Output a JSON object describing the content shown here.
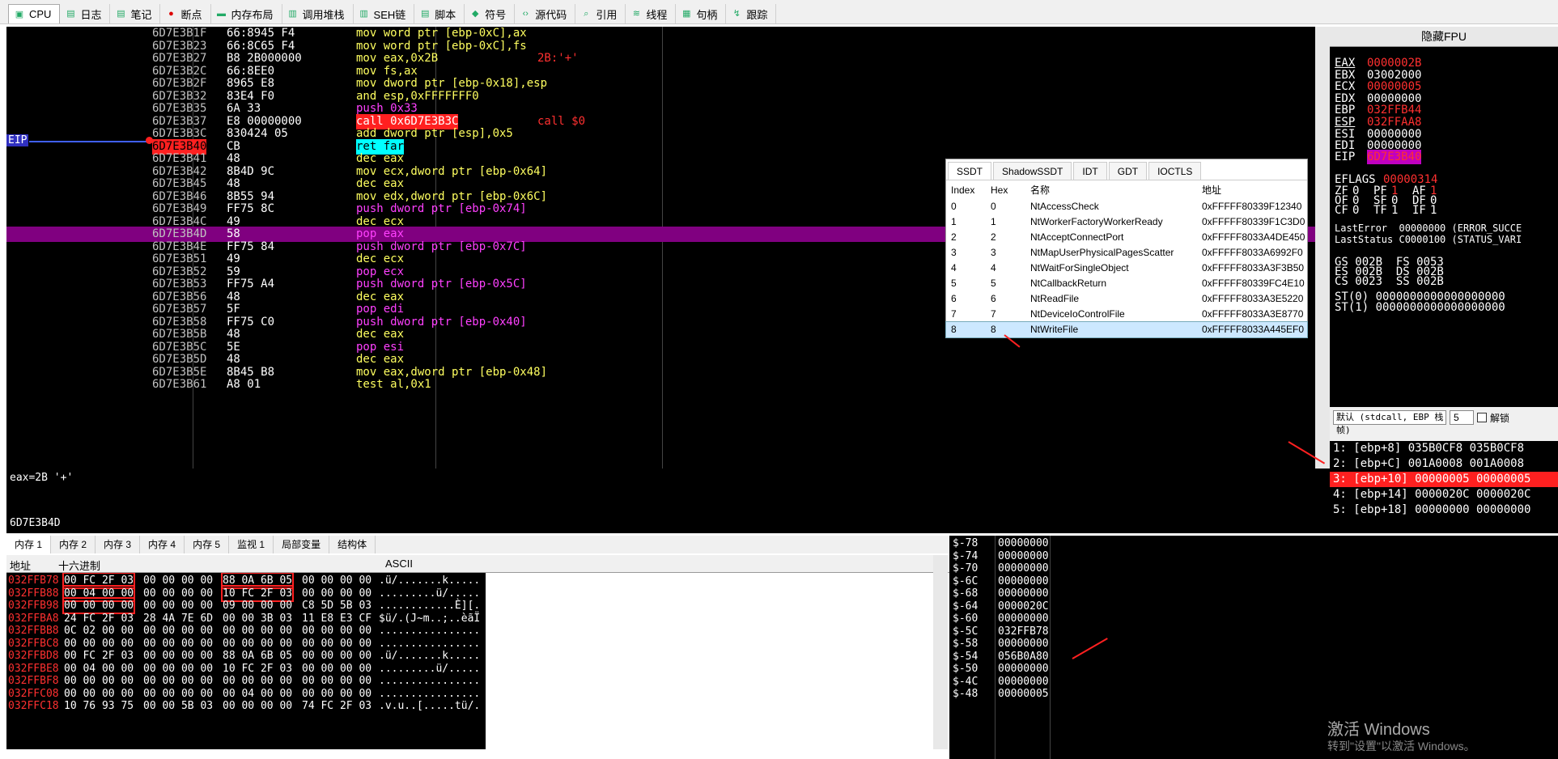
{
  "tabs": [
    {
      "label": "CPU",
      "icon": "cpu-icon"
    },
    {
      "label": "日志",
      "icon": "log-icon"
    },
    {
      "label": "笔记",
      "icon": "notes-icon"
    },
    {
      "label": "断点",
      "icon": "breakpoint-icon"
    },
    {
      "label": "内存布局",
      "icon": "memory-map-icon"
    },
    {
      "label": "调用堆栈",
      "icon": "callstack-icon"
    },
    {
      "label": "SEH链",
      "icon": "seh-icon"
    },
    {
      "label": "脚本",
      "icon": "script-icon"
    },
    {
      "label": "符号",
      "icon": "symbol-icon"
    },
    {
      "label": "源代码",
      "icon": "source-icon"
    },
    {
      "label": "引用",
      "icon": "references-icon"
    },
    {
      "label": "线程",
      "icon": "threads-icon"
    },
    {
      "label": "句柄",
      "icon": "handles-icon"
    },
    {
      "label": "跟踪",
      "icon": "trace-icon"
    }
  ],
  "eip_label": "EIP",
  "disasm": [
    {
      "a": "6D7E3B1F",
      "b": "66:8945 F4",
      "i": "mov word ptr [ebp-0xC],ax",
      "c": ""
    },
    {
      "a": "6D7E3B23",
      "b": "66:8C65 F4",
      "i": "mov word ptr [ebp-0xC],fs",
      "c": ""
    },
    {
      "a": "6D7E3B27",
      "b": "B8 2B000000",
      "i": "mov eax,0x2B",
      "c": "2B:'+'"
    },
    {
      "a": "6D7E3B2C",
      "b": "66:8EE0",
      "i": "mov fs,ax",
      "c": ""
    },
    {
      "a": "6D7E3B2F",
      "b": "8965 E8",
      "i": "mov dword ptr [ebp-0x18],esp",
      "c": ""
    },
    {
      "a": "6D7E3B32",
      "b": "83E4 F0",
      "i": "and esp,0xFFFFFFF0",
      "c": ""
    },
    {
      "a": "6D7E3B35",
      "b": "6A 33",
      "i": "push 0x33",
      "c": ""
    },
    {
      "a": "6D7E3B37",
      "b": "E8 00000000",
      "i": "call 0x6D7E3B3C",
      "c": "call $0"
    },
    {
      "a": "6D7E3B3C",
      "b": "830424 05",
      "i": "add dword ptr [esp],0x5",
      "c": ""
    },
    {
      "a": "6D7E3B40",
      "b": "CB",
      "i": "ret far",
      "c": ""
    },
    {
      "a": "6D7E3B41",
      "b": "48",
      "i": "dec eax",
      "c": ""
    },
    {
      "a": "6D7E3B42",
      "b": "8B4D 9C",
      "i": "mov ecx,dword ptr [ebp-0x64]",
      "c": ""
    },
    {
      "a": "6D7E3B45",
      "b": "48",
      "i": "dec eax",
      "c": ""
    },
    {
      "a": "6D7E3B46",
      "b": "8B55 94",
      "i": "mov edx,dword ptr [ebp-0x6C]",
      "c": ""
    },
    {
      "a": "6D7E3B49",
      "b": "FF75 8C",
      "i": "push dword ptr [ebp-0x74]",
      "c": ""
    },
    {
      "a": "6D7E3B4C",
      "b": "49",
      "i": "dec ecx",
      "c": ""
    },
    {
      "a": "6D7E3B4D",
      "b": "58",
      "i": "pop eax",
      "c": ""
    },
    {
      "a": "6D7E3B4E",
      "b": "FF75 84",
      "i": "push dword ptr [ebp-0x7C]",
      "c": ""
    },
    {
      "a": "6D7E3B51",
      "b": "49",
      "i": "dec ecx",
      "c": ""
    },
    {
      "a": "6D7E3B52",
      "b": "59",
      "i": "pop ecx",
      "c": ""
    },
    {
      "a": "6D7E3B53",
      "b": "FF75 A4",
      "i": "push dword ptr [ebp-0x5C]",
      "c": ""
    },
    {
      "a": "6D7E3B56",
      "b": "48",
      "i": "dec eax",
      "c": ""
    },
    {
      "a": "6D7E3B57",
      "b": "5F",
      "i": "pop edi",
      "c": ""
    },
    {
      "a": "6D7E3B58",
      "b": "FF75 C0",
      "i": "push dword ptr [ebp-0x40]",
      "c": ""
    },
    {
      "a": "6D7E3B5B",
      "b": "48",
      "i": "dec eax",
      "c": ""
    },
    {
      "a": "6D7E3B5C",
      "b": "5E",
      "i": "pop esi",
      "c": ""
    },
    {
      "a": "6D7E3B5D",
      "b": "48",
      "i": "dec eax",
      "c": ""
    },
    {
      "a": "6D7E3B5E",
      "b": "8B45 B8",
      "i": "mov eax,dword ptr [ebp-0x48]",
      "c": ""
    },
    {
      "a": "6D7E3B61",
      "b": "A8 01",
      "i": "test al,0x1",
      "c": ""
    }
  ],
  "fpu_title": "隐藏FPU",
  "registers": [
    {
      "n": "EAX",
      "v": "0000002B",
      "red": true,
      "u": true
    },
    {
      "n": "EBX",
      "v": "03002000",
      "red": false,
      "u": false
    },
    {
      "n": "ECX",
      "v": "00000005",
      "red": true,
      "u": false
    },
    {
      "n": "EDX",
      "v": "00000000",
      "red": false,
      "u": false
    },
    {
      "n": "EBP",
      "v": "032FFB44",
      "red": true,
      "u": false
    },
    {
      "n": "ESP",
      "v": "032FFAA8",
      "red": true,
      "u": true
    },
    {
      "n": "ESI",
      "v": "00000000",
      "red": false,
      "u": false
    },
    {
      "n": "EDI",
      "v": "00000000",
      "red": false,
      "u": false
    }
  ],
  "eip": {
    "n": "EIP",
    "v": "6D7E3B40"
  },
  "eflags": {
    "n": "EFLAGS",
    "v": "00000314"
  },
  "flags": [
    [
      "ZF",
      "0",
      "PF",
      "1",
      "AF",
      "1"
    ],
    [
      "OF",
      "0",
      "SF",
      "0",
      "DF",
      "0"
    ],
    [
      "CF",
      "0",
      "TF",
      "1",
      "IF",
      "1"
    ]
  ],
  "lasterror": "LastError  00000000 (ERROR_SUCCE",
  "laststatus": "LastStatus C0000100 (STATUS_VARI",
  "segs": [
    "GS 002B  FS 0053",
    "ES 002B  DS 002B",
    "CS 0023  SS 002B"
  ],
  "st0": "ST(0) 0000000000000000000",
  "st1": "ST(1) 0000000000000000000",
  "callconv": "默认 (stdcall, EBP 栈帧)",
  "argcount": "5",
  "unlock": "解锁",
  "stackargs": [
    "1: [ebp+8] 035B0CF8 035B0CF8",
    "2: [ebp+C] 001A0008 001A0008",
    "3: [ebp+10] 00000005 00000005",
    "4: [ebp+14] 0000020C 0000020C",
    "5: [ebp+18] 00000000 00000000"
  ],
  "info_line1": "eax=2B '+'",
  "info_line2": "6D7E3B4D",
  "memtabs": [
    "内存 1",
    "内存 2",
    "内存 3",
    "内存 4",
    "内存 5",
    "监视 1",
    "局部变量",
    "结构体"
  ],
  "memhdr": {
    "addr": "地址",
    "hex": "十六进制",
    "ascii": "ASCII"
  },
  "memory": [
    {
      "a": "032FFB78",
      "h": [
        "00 FC 2F 03",
        "00 00 00 00",
        "88 0A 6B 05",
        "00 00 00 00"
      ],
      "s": ".ü/.......k....."
    },
    {
      "a": "032FFB88",
      "h": [
        "00 04 00 00",
        "00 00 00 00",
        "10 FC 2F 03",
        "00 00 00 00"
      ],
      "s": ".........ü/....."
    },
    {
      "a": "032FFB98",
      "h": [
        "00 00 00 00",
        "00 00 00 00",
        "09 00 00 00",
        "C8 5D 5B 03"
      ],
      "s": "............È][."
    },
    {
      "a": "032FFBA8",
      "h": [
        "24 FC 2F 03",
        "28 4A 7E 6D",
        "00 00 3B 03",
        "11 E8 E3 CF"
      ],
      "s": "$ü/.(J~m..;..èãÏ"
    },
    {
      "a": "032FFBB8",
      "h": [
        "0C 02 00 00",
        "00 00 00 00",
        "00 00 00 00",
        "00 00 00 00"
      ],
      "s": "................"
    },
    {
      "a": "032FFBC8",
      "h": [
        "00 00 00 00",
        "00 00 00 00",
        "00 00 00 00",
        "00 00 00 00"
      ],
      "s": "................"
    },
    {
      "a": "032FFBD8",
      "h": [
        "00 FC 2F 03",
        "00 00 00 00",
        "88 0A 6B 05",
        "00 00 00 00"
      ],
      "s": ".ü/.......k....."
    },
    {
      "a": "032FFBE8",
      "h": [
        "00 04 00 00",
        "00 00 00 00",
        "10 FC 2F 03",
        "00 00 00 00"
      ],
      "s": ".........ü/....."
    },
    {
      "a": "032FFBF8",
      "h": [
        "00 00 00 00",
        "00 00 00 00",
        "00 00 00 00",
        "00 00 00 00"
      ],
      "s": "................"
    },
    {
      "a": "032FFC08",
      "h": [
        "00 00 00 00",
        "00 00 00 00",
        "00 04 00 00",
        "00 00 00 00"
      ],
      "s": "................"
    },
    {
      "a": "032FFC18",
      "h": [
        "10 76 93 75",
        "00 00 5B 03",
        "00 00 00 00",
        "74 FC 2F 03"
      ],
      "s": ".v.u..[.....tü/."
    }
  ],
  "stack": [
    {
      "o": "$-78",
      "v": "00000000"
    },
    {
      "o": "$-74",
      "v": "00000000"
    },
    {
      "o": "$-70",
      "v": "00000000"
    },
    {
      "o": "$-6C",
      "v": "00000000"
    },
    {
      "o": "$-68",
      "v": "00000000"
    },
    {
      "o": "$-64",
      "v": "0000020C"
    },
    {
      "o": "$-60",
      "v": "00000000"
    },
    {
      "o": "$-5C",
      "v": "032FFB78"
    },
    {
      "o": "$-58",
      "v": "00000000"
    },
    {
      "o": "$-54",
      "v": "056B0A80"
    },
    {
      "o": "$-50",
      "v": "00000000"
    },
    {
      "o": "$-4C",
      "v": "00000000"
    },
    {
      "o": "$-48",
      "v": "00000005"
    }
  ],
  "ssdt": {
    "tabs": [
      "SSDT",
      "ShadowSSDT",
      "IDT",
      "GDT",
      "IOCTLS"
    ],
    "headers": [
      "Index",
      "Hex",
      "名称",
      "地址"
    ],
    "rows": [
      [
        "0",
        "0",
        "NtAccessCheck",
        "0xFFFFF80339F12340"
      ],
      [
        "1",
        "1",
        "NtWorkerFactoryWorkerReady",
        "0xFFFFF80339F1C3D0"
      ],
      [
        "2",
        "2",
        "NtAcceptConnectPort",
        "0xFFFFF8033A4DE450"
      ],
      [
        "3",
        "3",
        "NtMapUserPhysicalPagesScatter",
        "0xFFFFF8033A6992F0"
      ],
      [
        "4",
        "4",
        "NtWaitForSingleObject",
        "0xFFFFF8033A3F3B50"
      ],
      [
        "5",
        "5",
        "NtCallbackReturn",
        "0xFFFFF80339FC4E10"
      ],
      [
        "6",
        "6",
        "NtReadFile",
        "0xFFFFF8033A3E5220"
      ],
      [
        "7",
        "7",
        "NtDeviceIoControlFile",
        "0xFFFFF8033A3E8770"
      ],
      [
        "8",
        "8",
        "NtWriteFile",
        "0xFFFFF8033A445EF0"
      ]
    ]
  },
  "watermark": "激活 Windows",
  "watermark2": "转到\"设置\"以激活 Windows。"
}
